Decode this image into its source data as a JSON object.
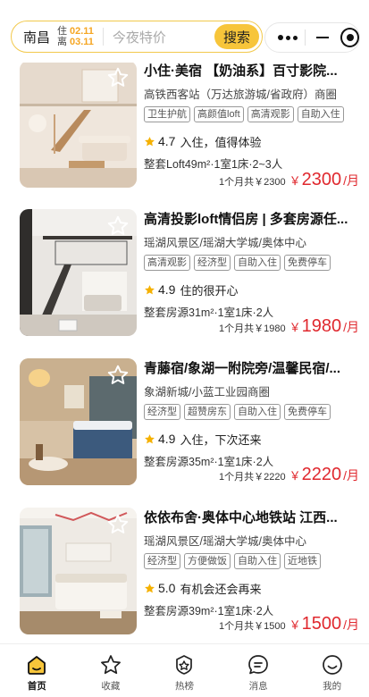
{
  "search": {
    "city": "南昌",
    "checkin_label": "住",
    "checkin_date": "02.11",
    "checkout_label": "离",
    "checkout_date": "03.11",
    "placeholder": "今夜特价",
    "button_label": "搜索"
  },
  "colors": {
    "accent": "#f7c53a",
    "price": "#e0282e",
    "star": "#f5b100"
  },
  "listings": [
    {
      "title": "小住·美宿 【奶油系】百寸影院...",
      "area": "高铁西客站（万达旅游城/省政府）商圈",
      "tags": [
        "卫生护航",
        "高颜值loft",
        "高清观影",
        "自助入住"
      ],
      "score": "4.7",
      "comment": "入住，值得体验",
      "spec": "整套Loft49m²·1室1床·2~3人",
      "total_label": "1个月共￥2300",
      "currency": "￥",
      "price": "2300",
      "unit": "/月"
    },
    {
      "title": "高清投影loft情侣房 | 多套房源任...",
      "area": "瑶湖风景区/瑶湖大学城/奥体中心",
      "tags": [
        "高清观影",
        "经济型",
        "自助入住",
        "免费停车"
      ],
      "score": "4.9",
      "comment": "住的很开心",
      "spec": "整套房源31m²·1室1床·2人",
      "total_label": "1个月共￥1980",
      "currency": "￥",
      "price": "1980",
      "unit": "/月"
    },
    {
      "title": "青藤宿/象湖一附院旁/温馨民宿/...",
      "area": "象湖新城/小蓝工业园商圈",
      "tags": [
        "经济型",
        "超赞房东",
        "自助入住",
        "免费停车"
      ],
      "score": "4.9",
      "comment": "入住，下次还来",
      "spec": "整套房源35m²·1室1床·2人",
      "total_label": "1个月共￥2220",
      "currency": "￥",
      "price": "2220",
      "unit": "/月"
    },
    {
      "title": "依依布舍·奥体中心地铁站 江西...",
      "area": "瑶湖风景区/瑶湖大学城/奥体中心",
      "tags": [
        "经济型",
        "方便做饭",
        "自助入住",
        "近地铁"
      ],
      "score": "5.0",
      "comment": "有机会还会再来",
      "spec": "整套房源39m²·1室1床·2人",
      "total_label": "1个月共￥1500",
      "currency": "￥",
      "price": "1500",
      "unit": "/月"
    }
  ],
  "tabbar": [
    {
      "label": "首页",
      "icon": "home-icon",
      "active": true
    },
    {
      "label": "收藏",
      "icon": "star-outline-icon"
    },
    {
      "label": "热榜",
      "icon": "badge-icon"
    },
    {
      "label": "消息",
      "icon": "chat-icon"
    },
    {
      "label": "我的",
      "icon": "smile-icon"
    }
  ]
}
